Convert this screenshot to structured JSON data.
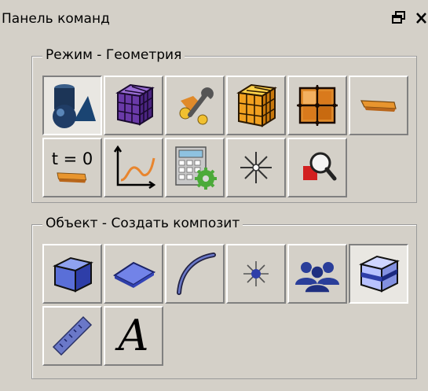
{
  "panel": {
    "title": "Панель команд"
  },
  "mode_group": {
    "label": "Режим - Геометрия",
    "tools": [
      {
        "icon": "geometry-shapes-icon",
        "active": true
      },
      {
        "icon": "mesh-cube-purple-icon"
      },
      {
        "icon": "wrench-tools-icon"
      },
      {
        "icon": "mesh-cube-orange-icon"
      },
      {
        "icon": "grid-surface-icon"
      },
      {
        "icon": "sheet-piece-icon"
      },
      {
        "icon": "initial-state-icon",
        "text": "t = 0"
      },
      {
        "icon": "xy-curve-icon"
      },
      {
        "icon": "calculator-gear-icon"
      },
      {
        "icon": "sparkle-point-icon"
      },
      {
        "icon": "magnify-query-icon"
      }
    ]
  },
  "object_group": {
    "label": "Объект - Создать композит",
    "tools": [
      {
        "icon": "volume-cube-icon"
      },
      {
        "icon": "face-surface-icon"
      },
      {
        "icon": "curve-edge-icon"
      },
      {
        "icon": "vertex-point-icon"
      },
      {
        "icon": "group-people-icon"
      },
      {
        "icon": "composite-cube-icon",
        "active": true
      },
      {
        "icon": "ruler-measure-icon"
      },
      {
        "icon": "text-letter-icon",
        "text": "A"
      }
    ]
  }
}
